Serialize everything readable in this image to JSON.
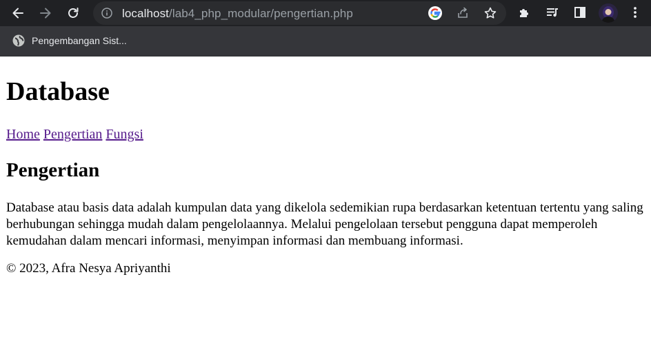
{
  "browser": {
    "url_host": "localhost",
    "url_path": "/lab4_php_modular/pengertian.php",
    "bookmarks": [
      {
        "label": "Pengembangan Sist..."
      }
    ]
  },
  "page": {
    "title": "Database",
    "nav": [
      {
        "label": "Home"
      },
      {
        "label": "Pengertian"
      },
      {
        "label": "Fungsi"
      }
    ],
    "section_heading": "Pengertian",
    "description": "Database atau basis data adalah kumpulan data yang dikelola sedemikian rupa berdasarkan ketentuan tertentu yang saling berhubungan sehingga mudah dalam pengelolaannya. Melalui pengelolaan tersebut pengguna dapat memperoleh kemudahan dalam mencari informasi, menyimpan informasi dan membuang informasi.",
    "footer": "© 2023, Afra Nesya Apriyanthi"
  },
  "colors": {
    "toolbar_bg": "#202124",
    "omnibox_bg": "#2b2c2f",
    "bookmarks_bg": "#35363a",
    "visited_link": "#551a8b"
  },
  "icons": [
    "back-arrow-icon",
    "forward-arrow-icon",
    "reload-icon",
    "info-icon",
    "google-icon",
    "share-icon",
    "star-icon",
    "puzzle-extension-icon",
    "media-queue-icon",
    "side-panel-icon",
    "more-vert-icon",
    "globe-icon"
  ]
}
